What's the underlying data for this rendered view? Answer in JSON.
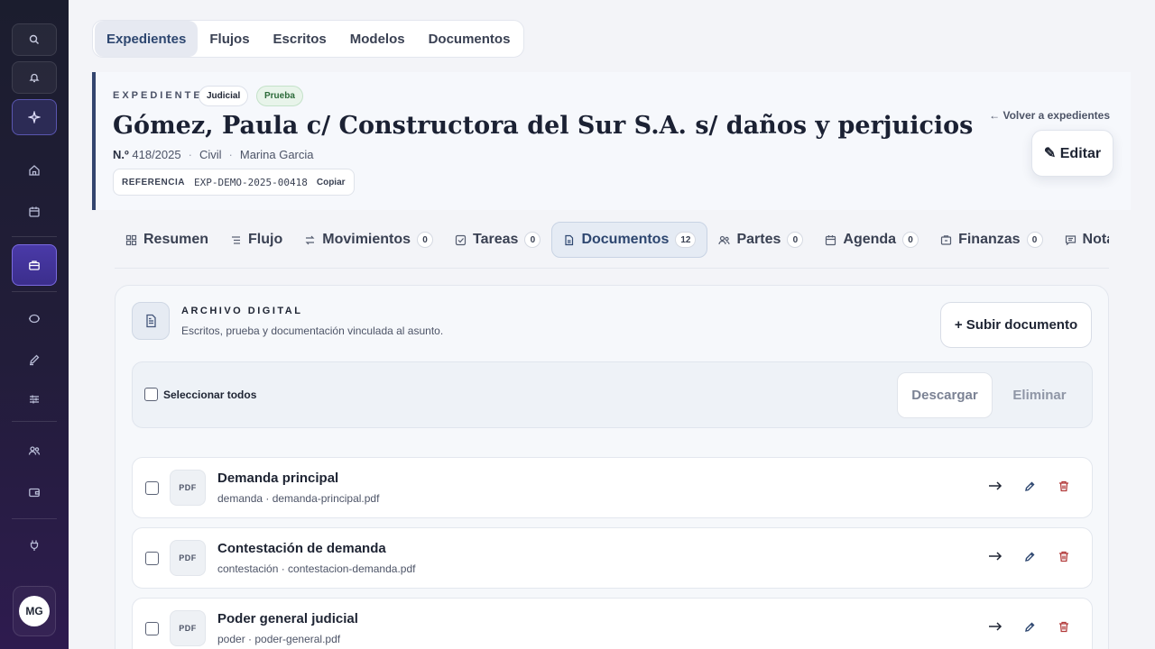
{
  "sidebar": {
    "avatar_initials": "MG",
    "icons": [
      "search-icon",
      "bell-icon",
      "sparkle-icon",
      "home-icon",
      "calendar-icon",
      "briefcase-icon",
      "chat-icon",
      "pen-icon",
      "sliders-icon",
      "users-icon",
      "wallet-icon",
      "plug-icon"
    ]
  },
  "top_tabs": [
    {
      "label": "Expedientes",
      "active": true
    },
    {
      "label": "Flujos"
    },
    {
      "label": "Escritos"
    },
    {
      "label": "Modelos"
    },
    {
      "label": "Documentos"
    }
  ],
  "header": {
    "eyebrow": "EXPEDIENTE",
    "badge_judicial": "Judicial",
    "badge_prueba": "Prueba",
    "title": "Gómez, Paula c/ Constructora del Sur S.A. s/ daños y perjuicios",
    "number_label": "N.º",
    "number_value": "418/2025",
    "fuero": "Civil",
    "responsable": "Marina Garcia",
    "reference_label": "REFERENCIA",
    "reference_code": "EXP-DEMO-2025-00418",
    "copy_label": "Copiar",
    "back_link": "← Volver a expedientes",
    "edit_label": "✎ Editar"
  },
  "content_tabs": [
    {
      "label": "Resumen",
      "icon": "grid-icon"
    },
    {
      "label": "Flujo",
      "icon": "list-icon"
    },
    {
      "label": "Movimientos",
      "count": "0",
      "icon": "arrows-icon"
    },
    {
      "label": "Tareas",
      "count": "0",
      "icon": "checkbox-icon"
    },
    {
      "label": "Documentos",
      "count": "12",
      "icon": "document-icon",
      "active": true
    },
    {
      "label": "Partes",
      "count": "0",
      "icon": "users-icon"
    },
    {
      "label": "Agenda",
      "count": "0",
      "icon": "calendar-icon"
    },
    {
      "label": "Finanzas",
      "count": "0",
      "icon": "wallet-icon"
    },
    {
      "label": "Notas",
      "icon": "note-icon"
    }
  ],
  "archive": {
    "title": "ARCHIVO DIGITAL",
    "subtitle": "Escritos, prueba y documentación vinculada al asunto.",
    "upload_label": "+ Subir documento",
    "select_all_label": "Seleccionar todos",
    "download_label": "Descargar",
    "delete_label": "Eliminar"
  },
  "documents": [
    {
      "type": "PDF",
      "title": "Demanda principal",
      "meta": "demanda · demanda-principal.pdf"
    },
    {
      "type": "PDF",
      "title": "Contestación de demanda",
      "meta": "contestación · contestacion-demanda.pdf"
    },
    {
      "type": "PDF",
      "title": "Poder general judicial",
      "meta": "poder · poder-general.pdf"
    }
  ],
  "colors": {
    "accent": "#2e4770",
    "sidebar_active": "#4a3aa8",
    "delete": "#b23a3a"
  }
}
